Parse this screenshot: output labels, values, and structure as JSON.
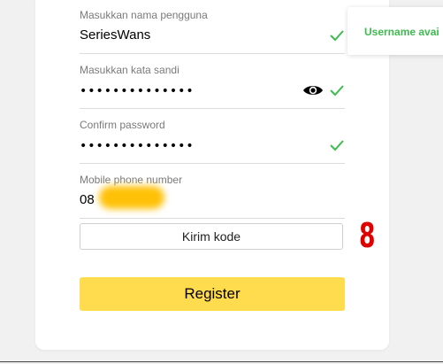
{
  "form": {
    "username": {
      "label": "Masukkan nama pengguna",
      "value": "SeriesWans",
      "valid": true
    },
    "password": {
      "label": "Masukkan kata sandi",
      "value": "••••••••••••••",
      "valid": true,
      "toggle_icon": "eye-icon"
    },
    "confirm_password": {
      "label": "Confirm password",
      "value": "••••••••••••••",
      "valid": true
    },
    "phone": {
      "label": "Mobile phone number",
      "value": "08"
    },
    "send_code_label": "Kirim kode",
    "register_label": "Register"
  },
  "tooltip": {
    "text": "Username avai"
  },
  "annotation": {
    "text": "8"
  },
  "colors": {
    "check_green": "#3fbb4f",
    "register_yellow": "#ffdb4d",
    "annotation_red": "#e00000",
    "redaction": "#ffc107"
  }
}
